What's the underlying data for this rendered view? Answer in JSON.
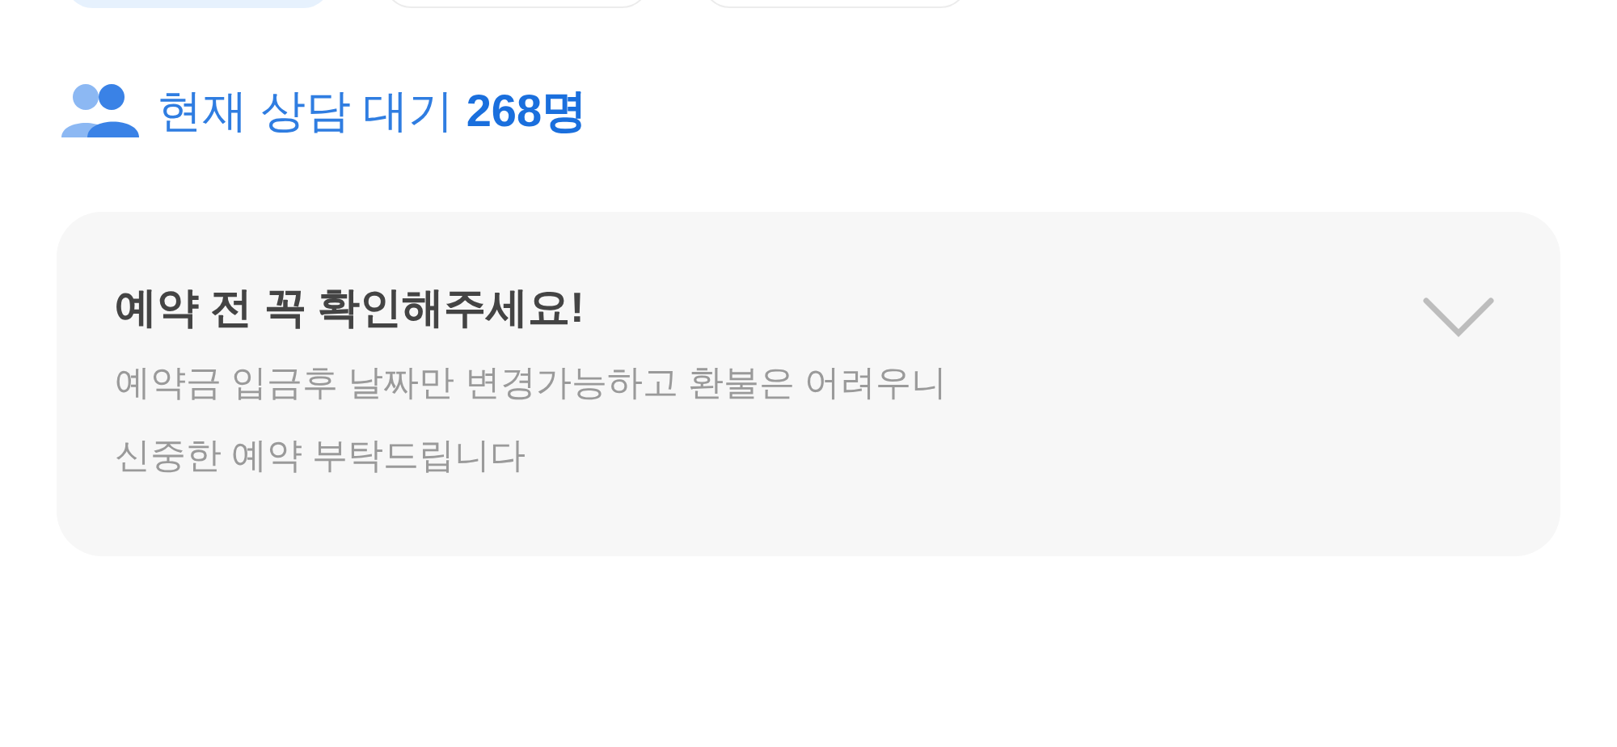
{
  "filter_chips": [
    {
      "selected": true
    },
    {
      "selected": false
    },
    {
      "selected": false
    }
  ],
  "waiting": {
    "text": "현재 상담 대기 **268명**"
  },
  "notice": {
    "title": "예약 전 꼭 확인해주세요!",
    "body": "예약금 입금후 날짜만 변경가능하고 환불은 어려우니\n신중한 예약 부탁드립니다",
    "expanded": false
  }
}
